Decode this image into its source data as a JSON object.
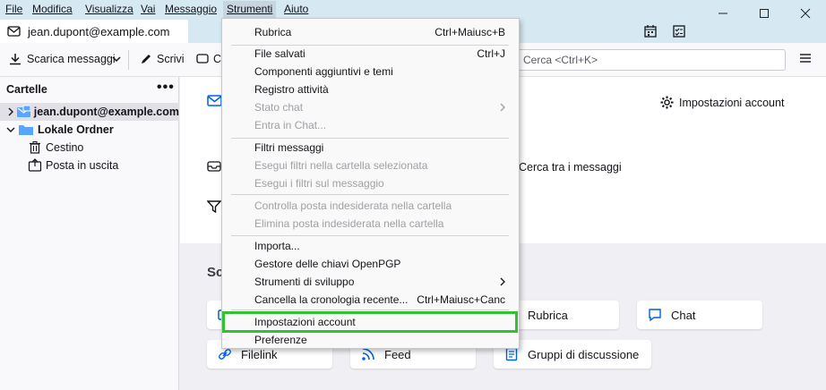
{
  "menubar": {
    "items": [
      "File",
      "Modifica",
      "Visualizza",
      "Vai",
      "Messaggio",
      "Strumenti",
      "Aiuto"
    ]
  },
  "tab": {
    "title": "jean.dupont@example.com"
  },
  "toolbar": {
    "get_messages": "Scarica messaggi",
    "write": "Scrivi",
    "chat_partial": "C",
    "search_placeholder": "Cerca <Ctrl+K>"
  },
  "sidebar": {
    "header": "Cartelle",
    "account": "jean.dupont@example.com",
    "local": "Lokale Ordner",
    "trash": "Cestino",
    "outbox": "Posta in uscita"
  },
  "content": {
    "account_settings": "Impostazioni account",
    "search_messages": "Cerca tra i messaggi",
    "section_partial": "Sc",
    "cards": {
      "address_book": "Rubrica",
      "chat": "Chat",
      "filelink": "Filelink",
      "feed": "Feed",
      "newsgroups": "Gruppi di discussione"
    }
  },
  "menu": {
    "rubrica": {
      "label": "Rubrica",
      "shortcut": "Ctrl+Maiusc+B"
    },
    "file_salvati": {
      "label": "File salvati",
      "shortcut": "Ctrl+J"
    },
    "componenti": {
      "label": "Componenti aggiuntivi e temi"
    },
    "registro": {
      "label": "Registro attività"
    },
    "stato_chat": {
      "label": "Stato chat"
    },
    "entra_chat": {
      "label": "Entra in Chat..."
    },
    "filtri": {
      "label": "Filtri messaggi"
    },
    "esegui_cartella": {
      "label": "Esegui filtri nella cartella selezionata"
    },
    "esegui_messaggio": {
      "label": "Esegui i filtri sul messaggio"
    },
    "controlla_indesiderata": {
      "label": "Controlla posta indesiderata nella cartella"
    },
    "elimina_indesiderata": {
      "label": "Elimina posta indesiderata nella cartella"
    },
    "importa": {
      "label": "Importa..."
    },
    "gestore_chiavi": {
      "label": "Gestore delle chiavi OpenPGP"
    },
    "strumenti_sviluppo": {
      "label": "Strumenti di sviluppo"
    },
    "cancella_cronologia": {
      "label": "Cancella la cronologia recente...",
      "shortcut": "Ctrl+Maiusc+Canc"
    },
    "impostazioni_account": {
      "label": "Impostazioni account"
    },
    "preferenze": {
      "label": "Preferenze"
    }
  },
  "colors": {
    "highlight": "#33c033",
    "titlebar": "#d6e8f2",
    "accent": "#0060df"
  }
}
